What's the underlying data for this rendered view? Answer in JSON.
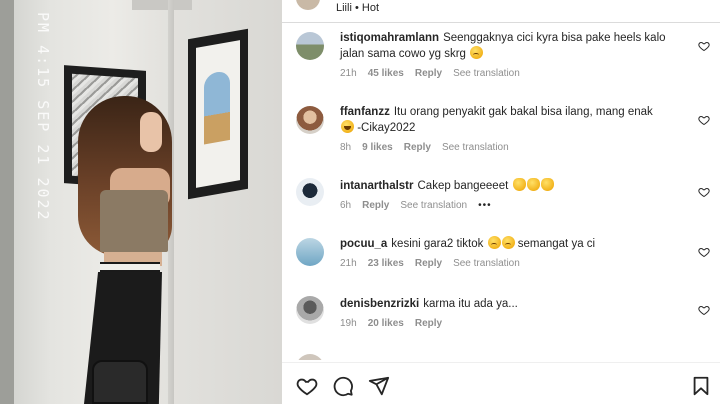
{
  "header": {
    "username": "Liili",
    "separator": "•",
    "tag": "Hot"
  },
  "media": {
    "timestamp": "PM 4:15 SEP 21 2022"
  },
  "comments": [
    {
      "username": "istiqomahramlann",
      "text": "Seenggaknya cici kyra bisa pake heels kalo jalan sama cowo yg skrg",
      "emoji": [
        "sad"
      ],
      "time": "21h",
      "likes": "45 likes",
      "reply": "Reply",
      "translate": "See translation",
      "more": ""
    },
    {
      "username": "ffanfanzz",
      "text": "Itu orang penyakit gak bakal bisa ilang, mang enak",
      "emoji_inline": [
        "laugh"
      ],
      "text_after": "-Cikay2022",
      "time": "8h",
      "likes": "9 likes",
      "reply": "Reply",
      "translate": "See translation",
      "more": ""
    },
    {
      "username": "intanarthalstr",
      "text": "Cakep bangeeeet",
      "emoji": [
        "clap",
        "clap",
        "clap"
      ],
      "time": "6h",
      "likes": "",
      "reply": "Reply",
      "translate": "See translation",
      "more": "•••"
    },
    {
      "username": "pocuu_a",
      "text": "kesini gara2 tiktok",
      "emoji_inline": [
        "sad",
        "sad"
      ],
      "text_after": "semangat ya ci",
      "time": "21h",
      "likes": "23 likes",
      "reply": "Reply",
      "translate": "See translation",
      "more": ""
    },
    {
      "username": "denisbenzrizki",
      "text": "karma itu ada ya...",
      "time": "19h",
      "likes": "20 likes",
      "reply": "Reply",
      "translate": "",
      "more": ""
    }
  ],
  "icons": {
    "like": "heart-icon",
    "comment": "comment-icon",
    "share": "paper-plane-icon",
    "save": "bookmark-icon",
    "comment_like": "small-heart-icon"
  },
  "colors": {
    "text": "#262626",
    "muted": "#8e8e8e",
    "divider": "#dbdbdb"
  }
}
